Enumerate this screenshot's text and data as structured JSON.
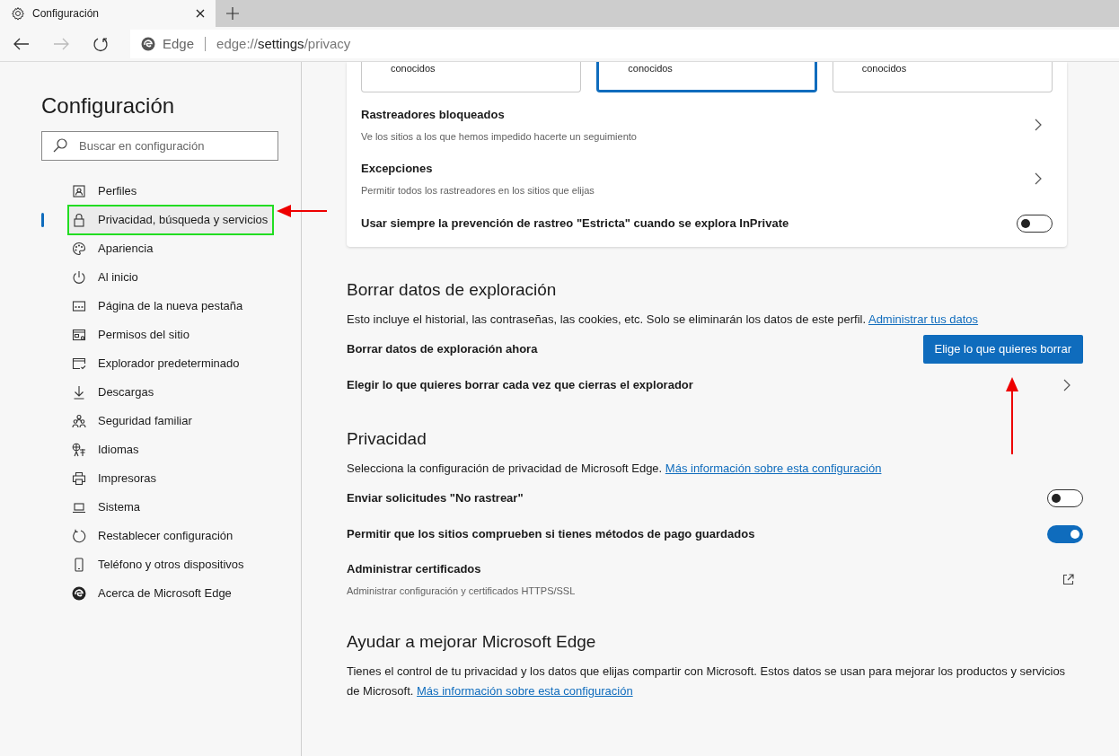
{
  "tab": {
    "title": "Configuración"
  },
  "address_bar": {
    "site_label": "Edge",
    "url_prefix": "edge://",
    "url_host": "settings",
    "url_path": "/privacy"
  },
  "sidebar": {
    "title": "Configuración",
    "search": {
      "placeholder": "Buscar en configuración"
    },
    "items": [
      {
        "label": "Perfiles",
        "selected": false
      },
      {
        "label": "Privacidad, búsqueda y servicios",
        "selected": true
      },
      {
        "label": "Apariencia",
        "selected": false
      },
      {
        "label": "Al inicio",
        "selected": false
      },
      {
        "label": "Página de la nueva pestaña",
        "selected": false
      },
      {
        "label": "Permisos del sitio",
        "selected": false
      },
      {
        "label": "Explorador predeterminado",
        "selected": false
      },
      {
        "label": "Descargas",
        "selected": false
      },
      {
        "label": "Seguridad familiar",
        "selected": false
      },
      {
        "label": "Idiomas",
        "selected": false
      },
      {
        "label": "Impresoras",
        "selected": false
      },
      {
        "label": "Sistema",
        "selected": false
      },
      {
        "label": "Restablecer configuración",
        "selected": false
      },
      {
        "label": "Teléfono y otros dispositivos",
        "selected": false
      },
      {
        "label": "Acerca de Microsoft Edge",
        "selected": false
      }
    ]
  },
  "tracking_card": {
    "levels": [
      {
        "text": "conocidos",
        "selected": false
      },
      {
        "text": "conocidos",
        "selected": true
      },
      {
        "text": "conocidos",
        "selected": false
      }
    ],
    "rows": [
      {
        "kind": "link",
        "title": "Rastreadores bloqueados",
        "subtitle": "Ve los sitios a los que hemos impedido hacerte un seguimiento"
      },
      {
        "kind": "link",
        "title": "Excepciones",
        "subtitle": "Permitir todos los rastreadores en los sitios que elijas"
      },
      {
        "kind": "toggle",
        "title": "Usar siempre la prevención de rastreo \"Estricta\" cuando se explora InPrivate",
        "on": false
      }
    ]
  },
  "sections": [
    {
      "heading": "Borrar datos de exploración",
      "description": "Esto incluye el historial, las contraseñas, las cookies, etc. Solo se eliminarán los datos de este perfil.",
      "link": "Administrar tus datos",
      "rows": [
        {
          "kind": "button",
          "title": "Borrar datos de exploración ahora",
          "button": "Elige lo que quieres borrar"
        },
        {
          "kind": "link",
          "title": "Elegir lo que quieres borrar cada vez que cierras el explorador"
        }
      ]
    },
    {
      "heading": "Privacidad",
      "description": "Selecciona la configuración de privacidad de Microsoft Edge.",
      "link": "Más información sobre esta configuración",
      "rows": [
        {
          "kind": "toggle",
          "title": "Enviar solicitudes \"No rastrear\"",
          "on": false
        },
        {
          "kind": "toggle",
          "title": "Permitir que los sitios comprueben si tienes métodos de pago guardados",
          "on": true
        },
        {
          "kind": "external",
          "title": "Administrar certificados",
          "subtitle": "Administrar configuración y certificados HTTPS/SSL"
        }
      ]
    },
    {
      "heading": "Ayudar a mejorar Microsoft Edge",
      "description": "Tienes el control de tu privacidad y los datos que elijas compartir con Microsoft. Estos datos se usan para mejorar los productos y servicios de Microsoft.",
      "link": "Más información sobre esta configuración"
    }
  ]
}
